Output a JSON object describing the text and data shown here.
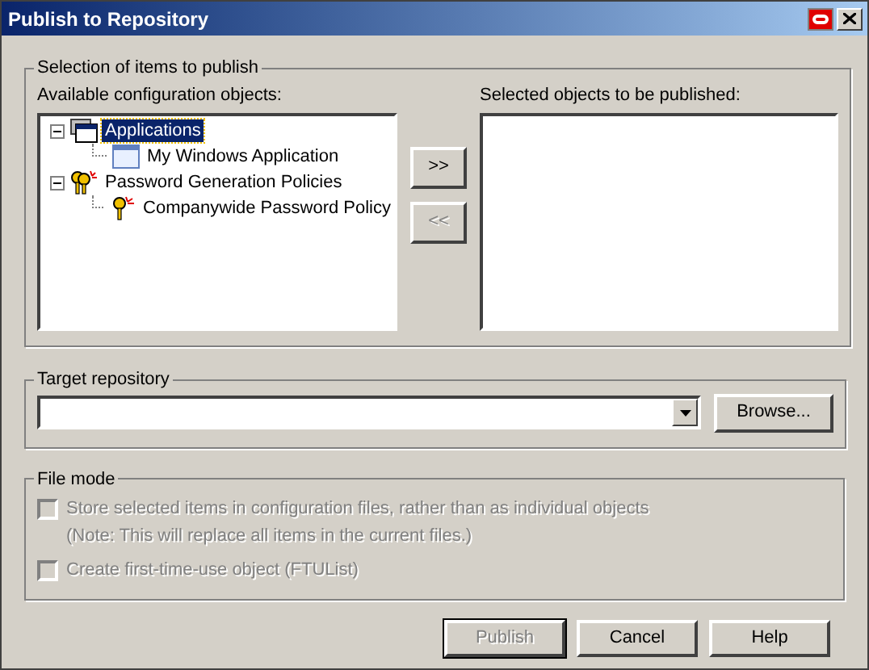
{
  "window": {
    "title": "Publish to Repository"
  },
  "selection_group": {
    "title": "Selection of items to publish",
    "available": {
      "label": "Available configuration objects:",
      "tree": [
        {
          "label": "Applications",
          "kind": "applications",
          "expanded": true,
          "selected": true,
          "children": [
            {
              "label": "My Windows Application",
              "kind": "window",
              "selected": false
            }
          ]
        },
        {
          "label": "Password Generation Policies",
          "kind": "keys",
          "expanded": true,
          "selected": false,
          "children": [
            {
              "label": "Companywide Password Policy",
              "kind": "key",
              "selected": false
            }
          ]
        }
      ]
    },
    "add_button": {
      "label": ">>",
      "disabled": false
    },
    "remove_button": {
      "label": "<<",
      "disabled": true
    },
    "selected": {
      "label": "Selected objects to be published:"
    }
  },
  "target_group": {
    "title": "Target repository",
    "browse_button": "Browse..."
  },
  "file_mode_group": {
    "title": "File mode",
    "options": [
      {
        "label": "Store selected items in configuration files, rather than as individual objects",
        "note": "(Note: This will replace all items in the current files.)",
        "checked": false,
        "disabled": true
      },
      {
        "label": "Create first-time-use object (FTUList)",
        "checked": false,
        "disabled": true
      }
    ]
  },
  "buttons": [
    {
      "label": "Publish",
      "disabled": true,
      "default": true
    },
    {
      "label": "Cancel",
      "disabled": false,
      "default": false
    },
    {
      "label": "Help",
      "disabled": false,
      "default": false
    }
  ]
}
